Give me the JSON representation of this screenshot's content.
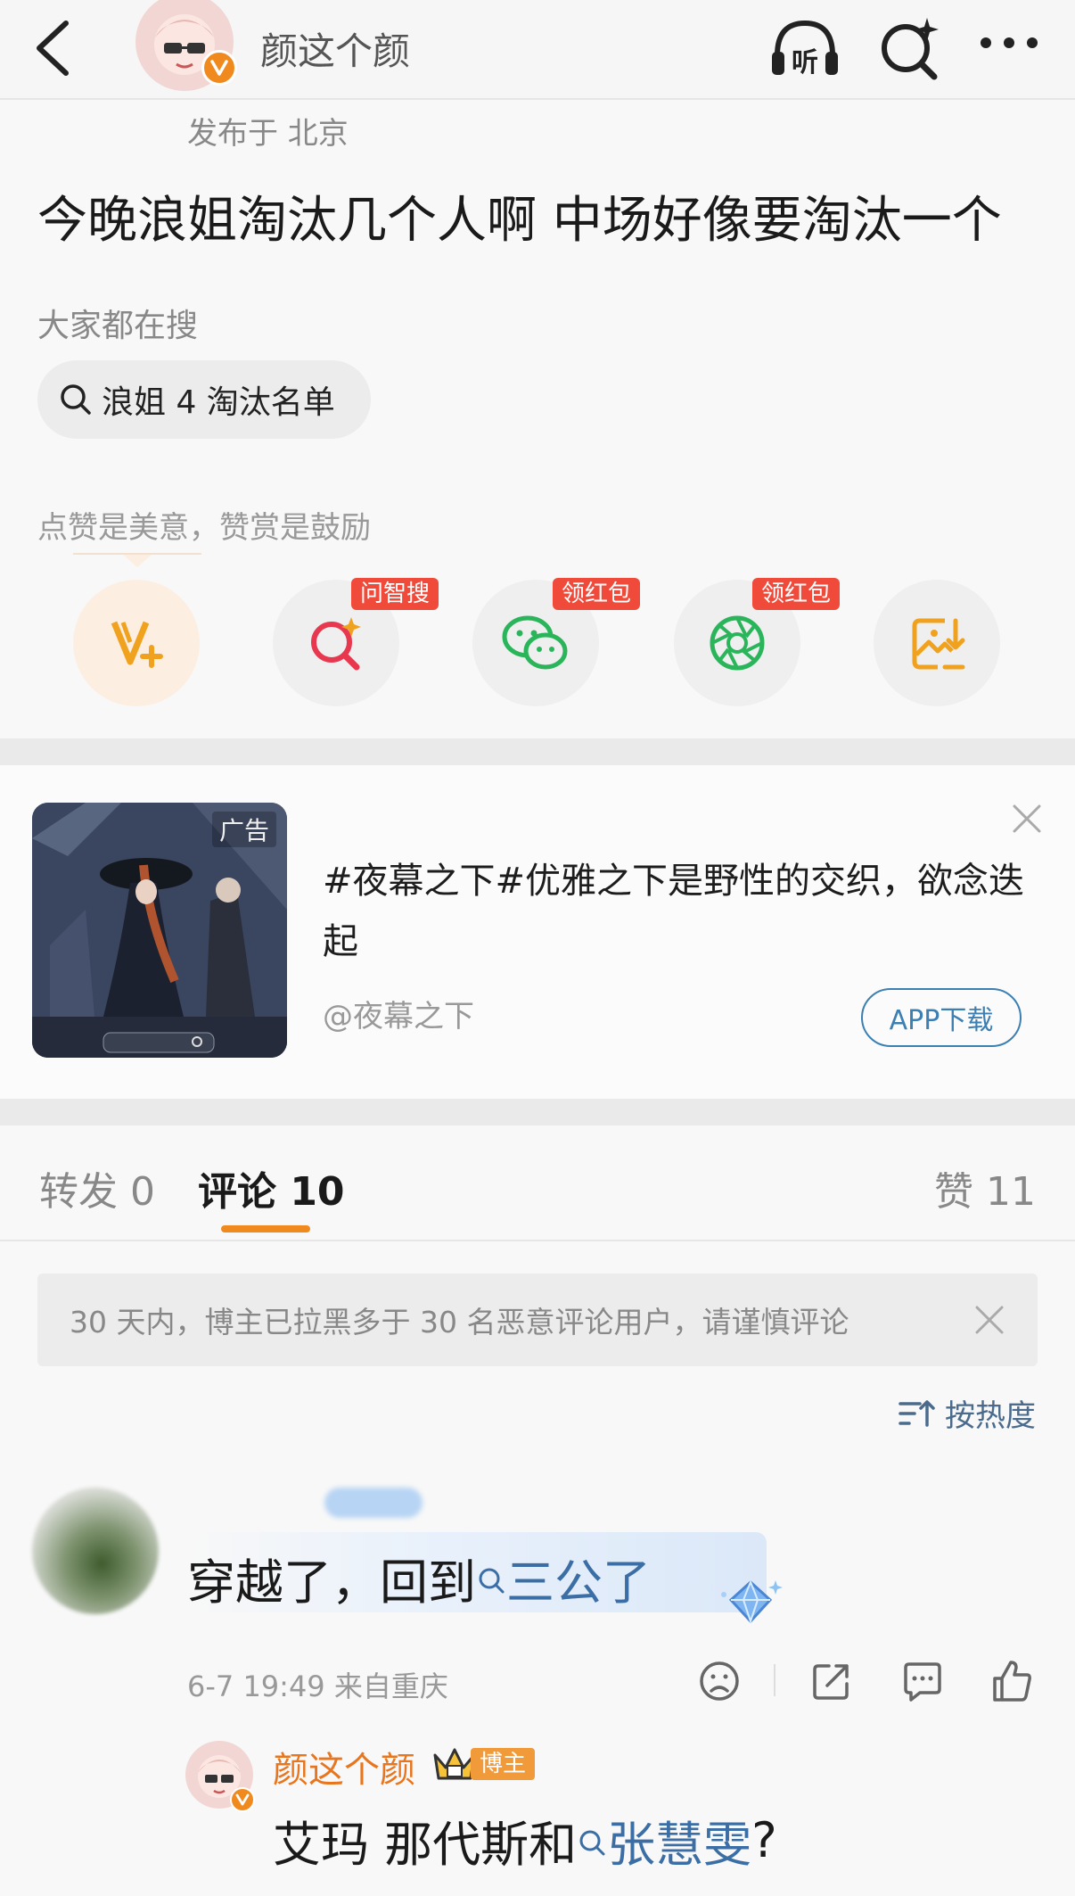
{
  "header": {
    "user_name": "颜这个颜",
    "icons": [
      "back-icon",
      "listen-icon",
      "ai-search-icon",
      "more-icon"
    ]
  },
  "post": {
    "location": "发布于 北京",
    "text": "今晚浪姐淘汰几个人啊 中场好像要淘汰一个",
    "search_label": "大家都在搜",
    "search_chip": "浪姐 4 淘汰名单",
    "like_hint": "点赞是美意，赞赏是鼓励",
    "actions": [
      {
        "icon": "reward-v-icon",
        "tag": ""
      },
      {
        "icon": "ai-search-icon",
        "tag": "问智搜"
      },
      {
        "icon": "wechat-icon",
        "tag": "领红包"
      },
      {
        "icon": "moments-icon",
        "tag": "领红包"
      },
      {
        "icon": "save-image-icon",
        "tag": ""
      }
    ]
  },
  "ad": {
    "tag": "广告",
    "text": "#夜幕之下#优雅之下是野性的交织，欲念迭起",
    "source": "@夜幕之下",
    "button": "APP下载"
  },
  "tabs": {
    "repost": "转发 0",
    "comment": "评论 10",
    "like": "赞 11"
  },
  "notice": "30 天内，博主已拉黑多于 30 名恶意评论用户，请谨慎评论",
  "sort": "按热度",
  "comment": {
    "text_prefix": "穿越了，回到",
    "link": "三公了",
    "meta": "6-7 19:49 来自重庆"
  },
  "reply": {
    "name": "颜这个颜",
    "badge": "博主",
    "text_prefix": "艾玛 那代斯和",
    "link": "张慧雯",
    "text_suffix": "?"
  },
  "colors": {
    "accent_orange": "#f08a1e",
    "link_blue": "#3c6ea6",
    "tag_red": "#f04a3a"
  }
}
